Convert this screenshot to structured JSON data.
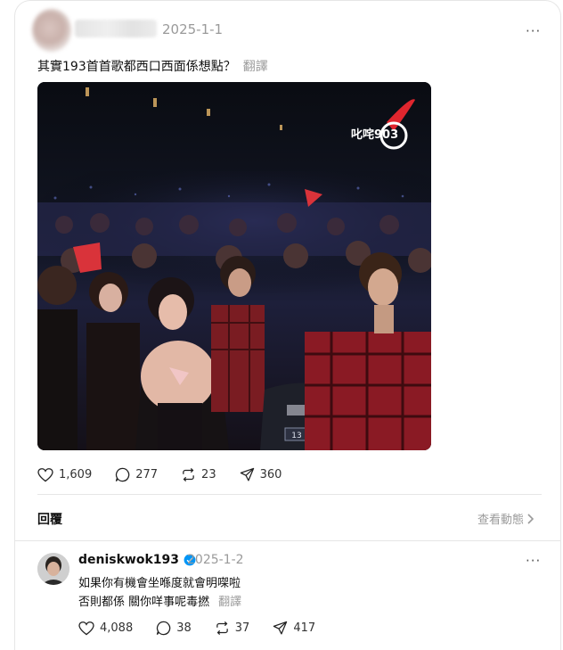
{
  "post": {
    "date": "2025-1-1",
    "more": "···",
    "text": "其實193首首歌都西口西面係想點？",
    "translate": "翻譯",
    "media_logo": "叱咤903",
    "seat_number": "13",
    "stats": {
      "likes": "1,609",
      "comments": "277",
      "reposts": "23",
      "shares": "360"
    }
  },
  "replies_header": {
    "label": "回覆",
    "view_activity": "查看動態"
  },
  "reply": {
    "username": "deniskwok193",
    "verified": true,
    "date": "2025-1-2",
    "more": "···",
    "line1": "如果你有機會坐喺度就會明㗎啦",
    "line2": "否則都係 關你咩事呢毒撚",
    "translate": "翻譯",
    "stats": {
      "likes": "4,088",
      "comments": "38",
      "reposts": "37",
      "shares": "417"
    }
  },
  "colors": {
    "verified": "#0095f6",
    "muted": "#9a9a9a",
    "logo_red": "#e0262e"
  }
}
